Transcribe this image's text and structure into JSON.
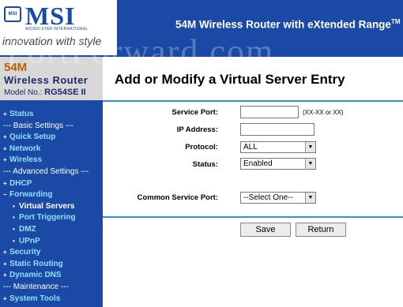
{
  "header": {
    "title": "54M Wireless Router with eXtended Range",
    "title_mark": "TM",
    "logo": {
      "brand": "MSI",
      "emblem": "MSI",
      "subtitle": "MICRO-STAR INTERNATIONAL",
      "tagline": "innovation with style"
    },
    "watermark": "PortForward.com"
  },
  "sidebar": {
    "model": {
      "size": "54M",
      "name": "Wireless Router",
      "model_label": "Model No.:",
      "model_number": "RG54SE II"
    },
    "items": [
      {
        "label": "Status",
        "type": "link"
      },
      {
        "label": "--- Basic Settings ---",
        "type": "section"
      },
      {
        "label": "Quick Setup",
        "type": "link"
      },
      {
        "label": "Network",
        "type": "link"
      },
      {
        "label": "Wireless",
        "type": "link"
      },
      {
        "label": "--- Advanced Settings ---",
        "type": "section"
      },
      {
        "label": "DHCP",
        "type": "link"
      },
      {
        "label": "Forwarding",
        "type": "link"
      },
      {
        "label": "Virtual Servers",
        "type": "sub-active"
      },
      {
        "label": "Port Triggering",
        "type": "sub"
      },
      {
        "label": "DMZ",
        "type": "sub"
      },
      {
        "label": "UPnP",
        "type": "sub"
      },
      {
        "label": "Security",
        "type": "link"
      },
      {
        "label": "Static Routing",
        "type": "link"
      },
      {
        "label": "Dynamic DNS",
        "type": "link"
      },
      {
        "label": "--- Maintenance ---",
        "type": "section"
      },
      {
        "label": "System Tools",
        "type": "link"
      }
    ]
  },
  "main": {
    "title": "Add or Modify a Virtual Server Entry",
    "form": {
      "service_port": {
        "label": "Service Port:",
        "value": "",
        "hint": "(XX-XX or XX)"
      },
      "ip_address": {
        "label": "IP Address:",
        "value": ""
      },
      "protocol": {
        "label": "Protocol:",
        "value": "ALL"
      },
      "status": {
        "label": "Status:",
        "value": "Enabled"
      },
      "common_service_port": {
        "label": "Common Service Port:",
        "value": "--Select One--"
      }
    },
    "buttons": {
      "save": "Save",
      "return": "Return"
    }
  },
  "colors": {
    "brand_blue": "#1a4aa6",
    "rule_blue": "#3a8fd1",
    "menu_link": "#8fe0ff",
    "model_orange": "#c05c00"
  }
}
